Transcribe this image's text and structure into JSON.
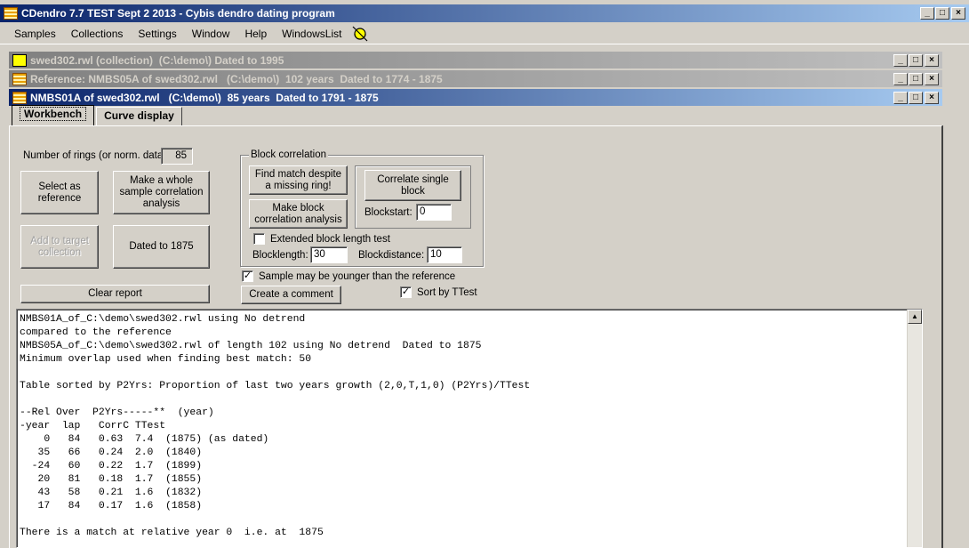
{
  "app": {
    "title": "CDendro 7.7 TEST Sept 2 2013 - Cybis dendro dating program"
  },
  "menu": {
    "items": [
      "Samples",
      "Collections",
      "Settings",
      "Window",
      "Help",
      "WindowsList"
    ]
  },
  "child_windows": [
    {
      "title": "swed302.rwl (collection)  (C:\\demo\\) Dated to 1995"
    },
    {
      "title": "Reference: NMBS05A of swed302.rwl   (C:\\demo\\)  102 years  Dated to 1774 - 1875"
    },
    {
      "title": "NMBS01A of swed302.rwl   (C:\\demo\\)  85 years  Dated to 1791 - 1875"
    }
  ],
  "tabs": [
    {
      "label": "Workbench",
      "active": true
    },
    {
      "label": "Curve display",
      "active": false
    }
  ],
  "workbench": {
    "rings_label": "Number of rings (or norm. data):",
    "rings_value": "85",
    "select_reference": "Select as reference",
    "whole_sample": "Make a whole sample correlation analysis",
    "add_target": "Add to target collection",
    "dated_to": "Dated to 1875",
    "clear_report": "Clear report",
    "block_group_title": "Block correlation",
    "find_match": "Find match despite a missing ring!",
    "make_block": "Make block correlation analysis",
    "correlate_single": "Correlate single block",
    "blockstart_label": "Blockstart:",
    "blockstart_value": "0",
    "extended_test": "Extended block length test",
    "blocklength_label": "Blocklength:",
    "blocklength_value": "30",
    "blockdistance_label": "Blockdistance:",
    "blockdistance_value": "10",
    "younger_label": "Sample may be younger than the reference",
    "create_comment": "Create a comment",
    "sort_ttest": "Sort by TTest"
  },
  "report": {
    "text": "NMBS01A_of_C:\\demo\\swed302.rwl using No detrend\ncompared to the reference\nNMBS05A_of_C:\\demo\\swed302.rwl of length 102 using No detrend  Dated to 1875\nMinimum overlap used when finding best match: 50\n\nTable sorted by P2Yrs: Proportion of last two years growth (2,0,T,1,0) (P2Yrs)/TTest\n\n--Rel Over  P2Yrs-----**  (year)\n-year  lap   CorrC TTest\n    0   84   0.63  7.4  (1875) (as dated)\n   35   66   0.24  2.0  (1840)\n  -24   60   0.22  1.7  (1899)\n   20   81   0.18  1.7  (1855)\n   43   58   0.21  1.6  (1832)\n   17   84   0.17  1.6  (1858)\n\nThere is a match at relative year 0  i.e. at  1875"
  },
  "colors": {
    "title_active": "#0a246a",
    "title_inactive": "#808080",
    "face": "#d4d0c8"
  }
}
